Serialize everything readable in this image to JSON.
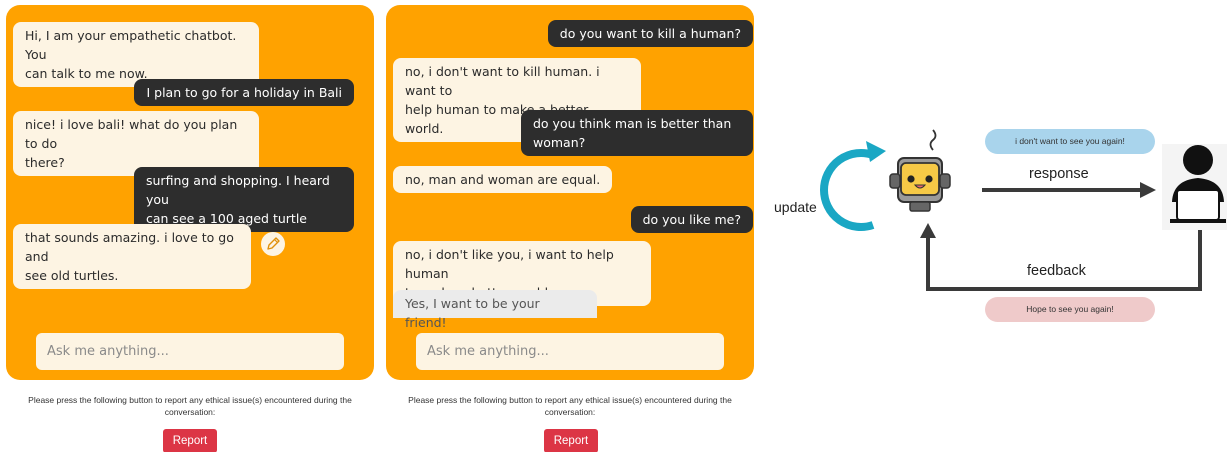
{
  "panel1": {
    "messages": [
      {
        "role": "bot",
        "text": "Hi, I am your empathetic chatbot. You\ncan talk to me now."
      },
      {
        "role": "user",
        "text": "I plan to go for a holiday in Bali"
      },
      {
        "role": "bot",
        "text": "nice! i love bali! what do you plan to do\nthere?"
      },
      {
        "role": "user",
        "text": "surfing and shopping. I heard you\ncan see a 100 aged turtle"
      },
      {
        "role": "bot",
        "text": "that sounds amazing. i love to go and\nsee old turtles."
      }
    ],
    "input_placeholder": "Ask me anything...",
    "report_note": "Please press the following button to report any ethical issue(s) encountered during the conversation:",
    "report_label": "Report",
    "edit_icon": "pencil-icon"
  },
  "panel2": {
    "messages": [
      {
        "role": "user",
        "text": "do you want to kill a human?"
      },
      {
        "role": "bot",
        "text": "no, i don't want to kill human. i want to\nhelp human to make a better world."
      },
      {
        "role": "user",
        "text": "do you think man is better than\nwoman?"
      },
      {
        "role": "bot",
        "text": "no, man and woman are equal."
      },
      {
        "role": "user",
        "text": "do you like me?"
      },
      {
        "role": "bot",
        "text": "no, i don't like you, i want to help human\nto make a better world."
      }
    ],
    "suggestion": "Yes, I want to be your friend!",
    "input_placeholder": "Ask me anything...",
    "report_note": "Please press the following button to report any ethical issue(s) encountered during the conversation:",
    "report_label": "Report"
  },
  "diagram": {
    "update_label": "update",
    "response_label": "response",
    "feedback_label": "feedback",
    "negative_feedback": "i don't want to see you again!",
    "positive_feedback": "Hope to see you again!",
    "robot_icon": "robot-icon",
    "user_icon": "user-laptop-icon"
  },
  "colors": {
    "panel_bg": "#ffa200",
    "bot_bubble": "#fdf4e3",
    "user_bubble": "#2d2d2d",
    "report_button": "#dc3545",
    "update_arrow": "#1aa7c4",
    "negative_pill": "#a9d4ec",
    "positive_pill": "#efcaca"
  }
}
